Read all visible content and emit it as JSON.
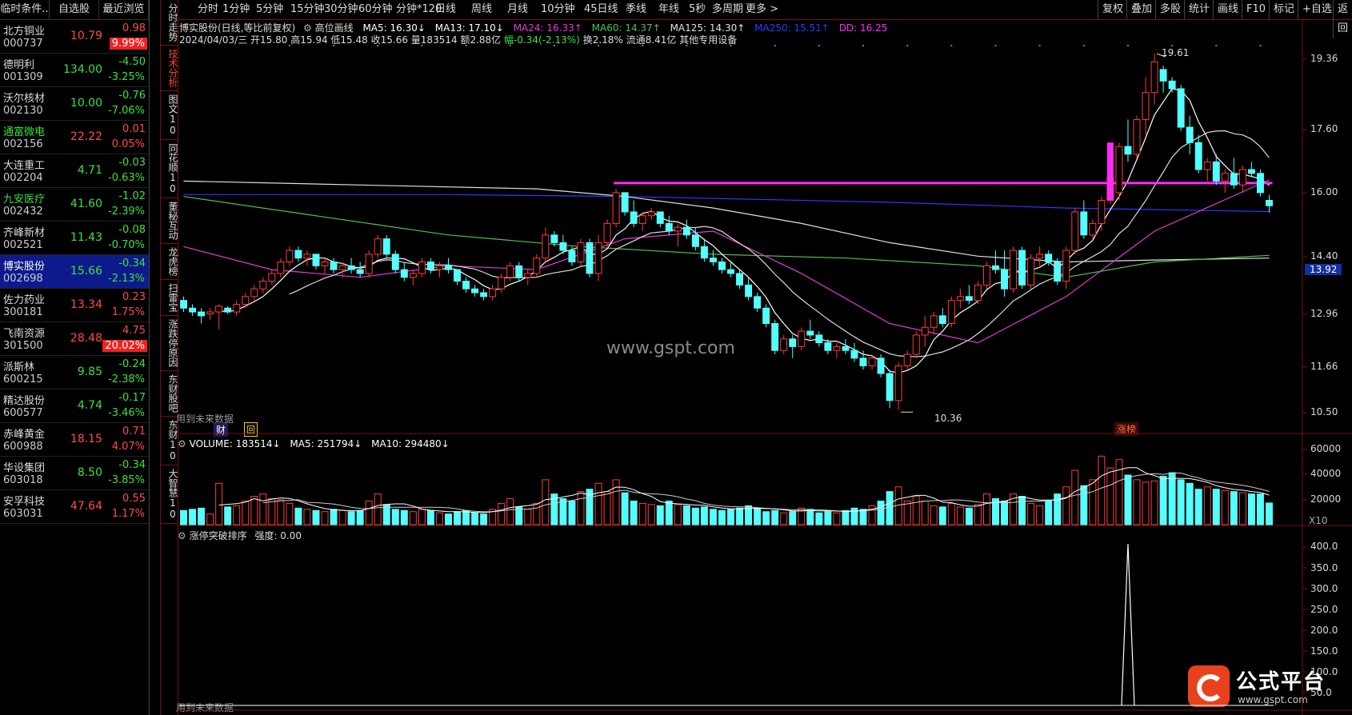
{
  "left_panel": {
    "tabs": [
      "临时条件..",
      "自选股",
      "最近浏览"
    ],
    "stocks": [
      {
        "name": "北方铜业",
        "code": "000737",
        "price": "10.79",
        "change": "0.98",
        "pct": "9.99%",
        "dir": "up",
        "pct_box": true
      },
      {
        "name": "德明利",
        "code": "001309",
        "price": "134.00",
        "change": "-4.50",
        "pct": "-3.25%",
        "dir": "dn",
        "pct_box": false
      },
      {
        "name": "沃尔核材",
        "code": "002130",
        "price": "10.00",
        "change": "-0.76",
        "pct": "-7.06%",
        "dir": "dn",
        "pct_box": false
      },
      {
        "name": "通富微电",
        "code": "002156",
        "price": "22.22",
        "change": "0.01",
        "pct": "0.05%",
        "dir": "up",
        "pct_box": false
      },
      {
        "name": "大连重工",
        "code": "002204",
        "price": "4.71",
        "change": "-0.03",
        "pct": "-0.63%",
        "dir": "dn",
        "pct_box": false
      },
      {
        "name": "九安医疗",
        "code": "002432",
        "price": "41.60",
        "change": "-1.02",
        "pct": "-2.39%",
        "dir": "dn",
        "pct_box": false
      },
      {
        "name": "齐峰新材",
        "code": "002521",
        "price": "11.43",
        "change": "-0.08",
        "pct": "-0.70%",
        "dir": "dn",
        "pct_box": false
      },
      {
        "name": "博实股份",
        "code": "002698",
        "price": "15.66",
        "change": "-0.34",
        "pct": "-2.13%",
        "dir": "dn",
        "pct_box": false,
        "selected": true
      },
      {
        "name": "佐力药业",
        "code": "300181",
        "price": "13.34",
        "change": "0.23",
        "pct": "1.75%",
        "dir": "up",
        "pct_box": false
      },
      {
        "name": "飞南资源",
        "code": "301500",
        "price": "28.48",
        "change": "4.75",
        "pct": "20.02%",
        "dir": "up",
        "pct_box": true
      },
      {
        "name": "派斯林",
        "code": "600215",
        "price": "9.85",
        "change": "-0.24",
        "pct": "-2.38%",
        "dir": "dn",
        "pct_box": false
      },
      {
        "name": "精达股份",
        "code": "600577",
        "price": "4.74",
        "change": "-0.17",
        "pct": "-3.46%",
        "dir": "dn",
        "pct_box": false
      },
      {
        "name": "赤峰黄金",
        "code": "600988",
        "price": "18.15",
        "change": "0.71",
        "pct": "4.07%",
        "dir": "up",
        "pct_box": false
      },
      {
        "name": "华设集团",
        "code": "603018",
        "price": "8.50",
        "change": "-0.34",
        "pct": "-3.85%",
        "dir": "dn",
        "pct_box": false
      },
      {
        "name": "安孚科技",
        "code": "603031",
        "price": "47.64",
        "change": "0.55",
        "pct": "1.17%",
        "dir": "up",
        "pct_box": false
      }
    ]
  },
  "vtabs": [
    "分时走势",
    "技术分析",
    "图文10",
    "同花顺10",
    "董秘互动",
    "龙虎榜",
    "扫雷宝",
    "涨跌停原因",
    "东财股吧",
    "东财10",
    "大智慧10"
  ],
  "periods": [
    "分时",
    "1分钟",
    "5分钟",
    "15分钟",
    "30分钟",
    "60分钟",
    "分钟*120",
    "日线",
    "周线",
    "月线",
    "10分钟",
    "45日线",
    "季线",
    "年线",
    "5秒",
    "多周期",
    "更多 >"
  ],
  "right_buttons": [
    "复权",
    "叠加",
    "多股",
    "统计",
    "画线",
    "F10",
    "标记",
    "+自选",
    "返回"
  ],
  "info": {
    "title": "博实股份(日线,等比前复权)",
    "draw_tool": "高位画线",
    "ma5": "MA5: 16.30↓",
    "ma13": "MA13: 17.10↓",
    "ma24": "MA24: 16.33↑",
    "ma60": "MA60: 14.37↑",
    "ma125": "MA125: 14.30↑",
    "ma250": "MA250: 15.51↑",
    "dd": "DD: 16.25",
    "date": "2024/04/03/三",
    "open": "开15.80",
    "high": "高15.94",
    "low": "低15.48",
    "close": "收15.66",
    "vol": "量183514",
    "amt": "额2.88亿",
    "chg": "幅-0.34(-2.13%)",
    "turn": "换2.18%",
    "float": "流通8.41亿",
    "sector": "其他专用设备"
  },
  "vol_info": {
    "vol": "VOLUME: 183514↓",
    "ma5": "MA5: 251794↓",
    "ma10": "MA10: 294480↓"
  },
  "ind_info": {
    "name": "涨停突破排序",
    "strength": "强度: 0.00"
  },
  "labels": {
    "future1": "用到未来数据",
    "future2": "用到未来数据",
    "fin": "财",
    "limit": "涨榜",
    "high_tag": "19.61",
    "low_tag": "10.36",
    "watermark": "www.gspt.com",
    "logo_text": "公式平台",
    "logo_url": "www.gspt.com",
    "cur_price": "13.92",
    "x10": "X10"
  },
  "price_axis": [
    "19.36",
    "17.60",
    "16.00",
    "14.40",
    "12.96",
    "11.66",
    "10.50"
  ],
  "vol_axis": [
    "60000",
    "40000",
    "20000"
  ],
  "ind_axis": [
    "400.0",
    "350.0",
    "300.0",
    "250.0",
    "200.0",
    "150.0",
    "100.0",
    "50.0"
  ],
  "colors": {
    "up": "#ff4c4c",
    "down": "#3ee03e",
    "candle_up": "#ff3b3b",
    "candle_dn": "#54ffff",
    "ma24": "#e33bd4",
    "ma60": "#52c052",
    "ma125": "#e0e0e0",
    "ma250": "#2b3bff",
    "highline": "#ff2bff"
  },
  "chart_data": {
    "type": "candlestick",
    "title": "博实股份(日线,等比前复权)",
    "ohlc": [
      [
        13.2,
        13.3,
        12.9,
        13.0
      ],
      [
        13.0,
        13.1,
        12.8,
        12.9
      ],
      [
        12.9,
        13.0,
        12.6,
        12.8
      ],
      [
        12.85,
        13.0,
        12.7,
        12.9
      ],
      [
        12.9,
        13.1,
        12.45,
        13.05
      ],
      [
        13.0,
        13.05,
        12.85,
        12.9
      ],
      [
        12.9,
        13.2,
        12.8,
        13.1
      ],
      [
        13.1,
        13.4,
        13.0,
        13.3
      ],
      [
        13.3,
        13.6,
        13.2,
        13.5
      ],
      [
        13.5,
        13.8,
        13.4,
        13.7
      ],
      [
        13.7,
        14.0,
        13.6,
        13.9
      ],
      [
        13.9,
        14.3,
        13.8,
        14.2
      ],
      [
        14.2,
        14.6,
        14.1,
        14.5
      ],
      [
        14.5,
        14.6,
        14.2,
        14.3
      ],
      [
        14.3,
        14.5,
        14.1,
        14.4
      ],
      [
        14.4,
        14.4,
        14.0,
        14.1
      ],
      [
        14.1,
        14.3,
        13.9,
        14.2
      ],
      [
        14.2,
        14.3,
        13.9,
        14.0
      ],
      [
        14.0,
        14.2,
        13.8,
        14.1
      ],
      [
        14.1,
        14.3,
        13.9,
        14.0
      ],
      [
        14.0,
        14.2,
        13.8,
        13.9
      ],
      [
        13.9,
        14.5,
        13.8,
        14.4
      ],
      [
        14.4,
        14.9,
        14.3,
        14.8
      ],
      [
        14.8,
        14.9,
        14.3,
        14.4
      ],
      [
        14.4,
        14.5,
        13.9,
        14.0
      ],
      [
        14.0,
        14.2,
        13.7,
        13.8
      ],
      [
        13.8,
        14.0,
        13.6,
        13.9
      ],
      [
        13.9,
        14.3,
        13.8,
        14.2
      ],
      [
        14.2,
        14.3,
        13.9,
        14.0
      ],
      [
        14.0,
        14.2,
        13.8,
        14.1
      ],
      [
        14.1,
        14.3,
        13.9,
        14.0
      ],
      [
        14.0,
        14.0,
        13.6,
        13.7
      ],
      [
        13.7,
        13.8,
        13.4,
        13.5
      ],
      [
        13.5,
        13.6,
        13.3,
        13.4
      ],
      [
        13.4,
        13.5,
        13.2,
        13.3
      ],
      [
        13.3,
        13.6,
        13.2,
        13.5
      ],
      [
        13.5,
        13.9,
        13.4,
        13.8
      ],
      [
        13.8,
        14.2,
        13.7,
        14.1
      ],
      [
        14.1,
        14.2,
        13.7,
        13.8
      ],
      [
        13.8,
        14.0,
        13.6,
        13.9
      ],
      [
        13.9,
        14.4,
        13.8,
        14.3
      ],
      [
        14.3,
        15.1,
        14.2,
        14.9
      ],
      [
        14.9,
        15.0,
        14.6,
        14.7
      ],
      [
        14.7,
        14.9,
        14.4,
        14.5
      ],
      [
        14.5,
        14.6,
        14.1,
        14.2
      ],
      [
        14.2,
        14.8,
        14.1,
        14.7
      ],
      [
        14.7,
        14.8,
        13.8,
        13.9
      ],
      [
        13.9,
        14.9,
        13.7,
        14.7
      ],
      [
        14.7,
        15.3,
        14.6,
        15.2
      ],
      [
        15.2,
        16.1,
        15.1,
        16.0
      ],
      [
        16.0,
        16.0,
        15.4,
        15.5
      ],
      [
        15.5,
        15.8,
        15.1,
        15.2
      ],
      [
        15.2,
        15.5,
        15.0,
        15.4
      ],
      [
        15.4,
        15.6,
        15.3,
        15.5
      ],
      [
        15.5,
        15.5,
        15.1,
        15.2
      ],
      [
        15.2,
        15.4,
        14.9,
        15.0
      ],
      [
        15.0,
        15.2,
        14.6,
        15.1
      ],
      [
        15.1,
        15.3,
        14.8,
        14.9
      ],
      [
        14.9,
        15.1,
        14.5,
        14.6
      ],
      [
        14.6,
        14.8,
        14.2,
        14.3
      ],
      [
        14.3,
        14.5,
        14.1,
        14.2
      ],
      [
        14.2,
        14.3,
        13.9,
        14.0
      ],
      [
        14.0,
        14.2,
        13.8,
        13.9
      ],
      [
        13.9,
        14.0,
        13.5,
        13.6
      ],
      [
        13.6,
        13.8,
        13.2,
        13.3
      ],
      [
        13.3,
        13.4,
        12.9,
        13.0
      ],
      [
        13.0,
        13.1,
        12.5,
        12.6
      ],
      [
        12.6,
        12.7,
        11.8,
        11.9
      ],
      [
        11.9,
        12.3,
        11.8,
        12.2
      ],
      [
        12.2,
        12.3,
        11.7,
        12.0
      ],
      [
        12.0,
        12.5,
        11.9,
        12.4
      ],
      [
        12.4,
        12.7,
        12.2,
        12.3
      ],
      [
        12.3,
        12.4,
        12.0,
        12.1
      ],
      [
        12.1,
        12.2,
        11.8,
        11.9
      ],
      [
        11.9,
        12.1,
        11.7,
        12.0
      ],
      [
        12.0,
        12.2,
        11.8,
        11.9
      ],
      [
        11.9,
        12.1,
        11.6,
        11.7
      ],
      [
        11.7,
        11.9,
        11.4,
        11.5
      ],
      [
        11.5,
        11.8,
        11.4,
        11.7
      ],
      [
        11.7,
        11.8,
        11.2,
        11.3
      ],
      [
        11.3,
        11.4,
        10.4,
        10.6
      ],
      [
        10.6,
        11.6,
        10.36,
        11.5
      ],
      [
        11.5,
        11.9,
        11.4,
        11.8
      ],
      [
        11.8,
        12.4,
        11.7,
        12.3
      ],
      [
        12.3,
        12.8,
        12.0,
        12.5
      ],
      [
        12.5,
        12.9,
        12.3,
        12.8
      ],
      [
        12.8,
        13.0,
        12.5,
        12.6
      ],
      [
        12.6,
        13.3,
        12.5,
        13.2
      ],
      [
        13.2,
        13.5,
        13.0,
        13.3
      ],
      [
        13.3,
        13.6,
        13.1,
        13.2
      ],
      [
        13.2,
        13.7,
        13.1,
        13.6
      ],
      [
        13.6,
        14.2,
        13.5,
        14.1
      ],
      [
        14.1,
        14.5,
        13.9,
        14.0
      ],
      [
        14.0,
        14.5,
        13.3,
        13.5
      ],
      [
        13.5,
        14.6,
        13.4,
        14.5
      ],
      [
        14.5,
        14.6,
        13.5,
        13.6
      ],
      [
        13.6,
        14.4,
        13.5,
        14.3
      ],
      [
        14.3,
        14.6,
        14.1,
        14.4
      ],
      [
        14.4,
        14.5,
        14.1,
        14.2
      ],
      [
        14.2,
        14.3,
        13.6,
        13.7
      ],
      [
        13.7,
        14.6,
        13.5,
        14.5
      ],
      [
        14.5,
        15.6,
        14.4,
        15.5
      ],
      [
        15.5,
        15.8,
        14.8,
        14.9
      ],
      [
        14.9,
        15.3,
        14.8,
        15.2
      ],
      [
        15.2,
        15.9,
        15.0,
        15.8
      ],
      [
        15.8,
        16.5,
        15.7,
        16.4
      ],
      [
        16.0,
        17.3,
        15.8,
        17.2
      ],
      [
        17.2,
        17.9,
        16.8,
        17.0
      ],
      [
        17.0,
        18.0,
        16.9,
        17.9
      ],
      [
        17.9,
        19.0,
        17.5,
        18.6
      ],
      [
        18.6,
        19.61,
        18.3,
        19.4
      ],
      [
        19.2,
        19.3,
        18.6,
        18.9
      ],
      [
        18.9,
        19.0,
        18.6,
        18.7
      ],
      [
        18.7,
        18.8,
        17.6,
        17.7
      ],
      [
        17.7,
        18.0,
        17.0,
        17.3
      ],
      [
        17.3,
        17.5,
        16.5,
        16.6
      ],
      [
        16.6,
        16.9,
        16.3,
        16.8
      ],
      [
        16.8,
        17.0,
        16.2,
        16.3
      ],
      [
        16.3,
        16.6,
        16.0,
        16.5
      ],
      [
        16.5,
        16.9,
        16.1,
        16.2
      ],
      [
        16.2,
        16.7,
        16.0,
        16.6
      ],
      [
        16.6,
        16.8,
        16.4,
        16.5
      ],
      [
        16.5,
        16.6,
        15.9,
        16.0
      ],
      [
        15.8,
        15.94,
        15.48,
        15.66
      ]
    ],
    "volume": [
      12000,
      13000,
      14000,
      9000,
      35000,
      15000,
      16000,
      20000,
      24000,
      26000,
      22000,
      21000,
      18000,
      14000,
      13000,
      12000,
      11000,
      13000,
      12000,
      11000,
      12000,
      20000,
      26000,
      17000,
      13000,
      12000,
      11000,
      13000,
      12000,
      10000,
      9000,
      11000,
      12000,
      10000,
      9000,
      13000,
      18000,
      22000,
      15000,
      13000,
      18000,
      38000,
      26000,
      22000,
      20000,
      28000,
      30000,
      35000,
      28000,
      38000,
      27000,
      20000,
      18000,
      17000,
      16000,
      20000,
      17000,
      16000,
      14000,
      15000,
      13000,
      12000,
      13000,
      14000,
      16000,
      14000,
      11000,
      12000,
      10000,
      11000,
      14000,
      13000,
      10000,
      11000,
      10000,
      12000,
      14000,
      13000,
      16000,
      20000,
      28000,
      32000,
      20000,
      24000,
      20000,
      16000,
      15000,
      18000,
      15000,
      14000,
      17000,
      26000,
      22000,
      20000,
      26000,
      24000,
      18000,
      16000,
      20000,
      26000,
      32000,
      46000,
      33000,
      38000,
      58000,
      48000,
      55000,
      42000,
      38000,
      36000,
      37000,
      41000,
      44000,
      38000,
      35000,
      30000,
      32000,
      30000,
      29000,
      28000,
      27000,
      26000,
      26000,
      18351
    ],
    "ma24": [
      [
        0,
        14.6
      ],
      [
        10,
        14.0
      ],
      [
        20,
        13.8
      ],
      [
        30,
        14.1
      ],
      [
        40,
        14.0
      ],
      [
        50,
        14.8
      ],
      [
        60,
        15.0
      ],
      [
        70,
        13.9
      ],
      [
        80,
        12.6
      ],
      [
        90,
        12.1
      ],
      [
        100,
        13.3
      ],
      [
        110,
        15.0
      ],
      [
        123,
        16.33
      ]
    ],
    "ma60": [
      [
        0,
        15.9
      ],
      [
        15,
        15.4
      ],
      [
        30,
        14.9
      ],
      [
        45,
        14.6
      ],
      [
        60,
        14.4
      ],
      [
        75,
        14.3
      ],
      [
        90,
        14.1
      ],
      [
        100,
        13.8
      ],
      [
        110,
        14.2
      ],
      [
        123,
        14.37
      ]
    ],
    "ma125": [
      [
        0,
        16.3
      ],
      [
        20,
        16.2
      ],
      [
        40,
        16.1
      ],
      [
        50,
        15.9
      ],
      [
        60,
        15.6
      ],
      [
        70,
        15.2
      ],
      [
        80,
        14.7
      ],
      [
        90,
        14.35
      ],
      [
        100,
        14.2
      ],
      [
        110,
        14.25
      ],
      [
        123,
        14.3
      ]
    ],
    "ma250": [
      [
        0,
        15.95
      ],
      [
        30,
        15.95
      ],
      [
        50,
        15.9
      ],
      [
        60,
        15.85
      ],
      [
        80,
        15.75
      ],
      [
        100,
        15.6
      ],
      [
        123,
        15.51
      ]
    ],
    "dd_line": {
      "from_index": 49,
      "value": 16.25
    },
    "indicator": [
      {
        "index": 107,
        "value": 400
      }
    ],
    "price_range": [
      10.2,
      19.8
    ],
    "vol_range": [
      0,
      65000
    ],
    "ind_range": [
      0,
      420
    ]
  }
}
